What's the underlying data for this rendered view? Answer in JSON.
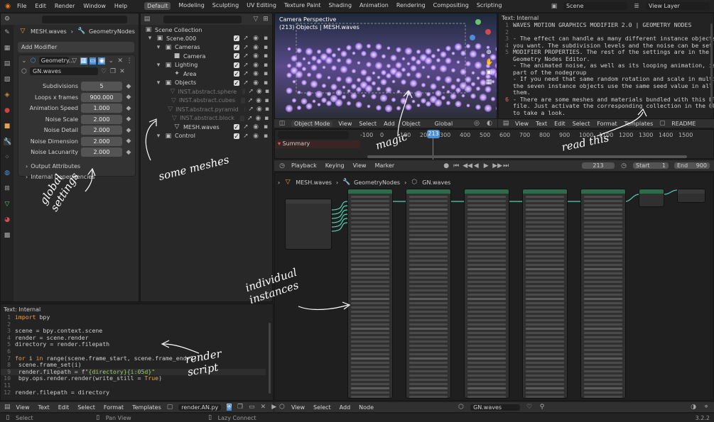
{
  "topbar": {
    "menus": [
      "File",
      "Edit",
      "Render",
      "Window",
      "Help"
    ],
    "workspaces": [
      "Default",
      "Modeling",
      "Sculpting",
      "UV Editing",
      "Texture Paint",
      "Shading",
      "Animation",
      "Rendering",
      "Compositing",
      "Scripting"
    ],
    "active_workspace": "Default",
    "scene": "Scene",
    "view_layer": "View Layer"
  },
  "properties": {
    "breadcrumb": [
      "MESH.waves",
      "GeometryNodes"
    ],
    "add_modifier": "Add Modifier",
    "modifier_name": "Geometry...",
    "node_group": "GN.waves",
    "fields": [
      {
        "label": "Subdivisions",
        "value": "5"
      },
      {
        "label": "Loops x frames",
        "value": "900.000"
      },
      {
        "label": "Animation Speed",
        "value": "1.000"
      },
      {
        "label": "Noise Scale",
        "value": "2.000"
      },
      {
        "label": "Noise Detail",
        "value": "2.000"
      },
      {
        "label": "Noise Dimension",
        "value": "2.000"
      },
      {
        "label": "Noise Lacunarity",
        "value": "2.000"
      }
    ],
    "panels": [
      "Output Attributes",
      "Internal Dependencies"
    ]
  },
  "outliner": {
    "title": "Scene Collection",
    "items": [
      {
        "label": "Scene.000",
        "depth": 0,
        "dim": false
      },
      {
        "label": "Cameras",
        "depth": 1,
        "dim": false
      },
      {
        "label": "Camera",
        "depth": 2,
        "dim": false
      },
      {
        "label": "Lighting",
        "depth": 1,
        "dim": false
      },
      {
        "label": "Area",
        "depth": 2,
        "dim": false
      },
      {
        "label": "Objects",
        "depth": 1,
        "dim": false
      },
      {
        "label": "INST.abstract.sphere",
        "depth": 2,
        "dim": true
      },
      {
        "label": "INST.abstract.cubes",
        "depth": 2,
        "dim": true
      },
      {
        "label": "INST.abstract.pyramid",
        "depth": 2,
        "dim": true
      },
      {
        "label": "INST.abstract.block",
        "depth": 2,
        "dim": true
      },
      {
        "label": "MESH.waves",
        "depth": 2,
        "dim": false
      },
      {
        "label": "Control",
        "depth": 1,
        "dim": false
      }
    ]
  },
  "viewport": {
    "title": "Camera Perspective",
    "subtitle": "(213) Objects | MESH.waves",
    "mode": "Object Mode",
    "menus": [
      "View",
      "Select",
      "Add",
      "Object"
    ],
    "orientation": "Global"
  },
  "text_top": {
    "title": "Text: Internal",
    "lines": [
      "WAVES MOTION GRAPHICS MODIFIER 2.0 | GEOMETRY NODES",
      "",
      "- The effect can handle as many different instance objects* as",
      "you want. The subdivision levels and the noise can be set in the",
      "MODIFIER PROPERTIES. The rest of the settings are in the",
      "Geometry Nodes Editor.",
      "- The animated noise, as well as its looping animation, is now",
      "part of the nodegroup",
      "- If you need that same random rotation and scale in multiple of",
      "the seven instance objects use the same seed value in all of",
      "them.",
      "- There are some meshes and materials bundled with this blend-",
      "file. Just activate the corresponding collection in the OUTLINER",
      "to take a look."
    ],
    "line_numbers": [
      "1",
      "2",
      "3",
      "4",
      "5",
      "",
      "",
      "",
      "",
      "",
      "",
      "6",
      "",
      ""
    ],
    "menus": [
      "View",
      "Text",
      "Edit",
      "Select",
      "Format",
      "Templates"
    ],
    "file": "README"
  },
  "timeline": {
    "ticks": [
      "-100",
      "0",
      "100",
      "200",
      "300",
      "400",
      "500",
      "600",
      "700",
      "800",
      "900",
      "1000",
      "1100",
      "1200",
      "1300",
      "1400",
      "1500"
    ],
    "current_frame": "213",
    "summary": "Summary",
    "menus": [
      "Playback",
      "Keying",
      "View",
      "Marker"
    ],
    "frame_field": "213",
    "start_label": "Start",
    "start": "1",
    "end_label": "End",
    "end": "900"
  },
  "node_editor": {
    "breadcrumb": [
      "MESH.waves",
      "GeometryNodes",
      "GN.waves"
    ],
    "menus": [
      "View",
      "Select",
      "Add",
      "Node"
    ],
    "node_group": "GN.waves"
  },
  "text_bottom": {
    "title": "Text: Internal",
    "line_numbers": [
      "1",
      "2",
      "3",
      "4",
      "5",
      "6",
      "7",
      "8",
      "9",
      "10",
      "11",
      "12"
    ],
    "menus": [
      "View",
      "Text",
      "Edit",
      "Select",
      "Format",
      "Templates"
    ],
    "file": "render.AN.py"
  },
  "status": {
    "select": "Select",
    "pan": "Pan View",
    "lazy": "Lazy Connect",
    "version": "3.2.2"
  },
  "annotations": {
    "global_settings": "global settings",
    "some_meshes": "some meshes",
    "magic": "magic",
    "read_this": "read this",
    "individual_instances": "individual instances",
    "render_script": "render script"
  }
}
